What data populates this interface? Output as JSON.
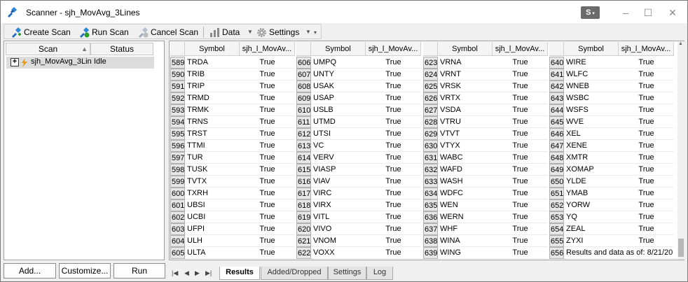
{
  "window": {
    "title": "Scanner - sjh_MovAvg_3Lines",
    "badge": "S"
  },
  "toolbar": {
    "create_scan": "Create Scan",
    "run_scan": "Run Scan",
    "cancel_scan": "Cancel Scan",
    "data": "Data",
    "settings": "Settings"
  },
  "left": {
    "col_scan": "Scan",
    "col_status": "Status",
    "scan_name": "sjh_MovAvg_3Lin",
    "scan_status": "Idle"
  },
  "buttons": {
    "add": "Add...",
    "customize": "Customize...",
    "run": "Run"
  },
  "grid": {
    "headers": [
      "Symbol",
      "sjh_l_MovAv..."
    ],
    "columns": [
      {
        "rows": [
          [
            "589",
            "TRDA",
            "True"
          ],
          [
            "590",
            "TRIB",
            "True"
          ],
          [
            "591",
            "TRIP",
            "True"
          ],
          [
            "592",
            "TRMD",
            "True"
          ],
          [
            "593",
            "TRMK",
            "True"
          ],
          [
            "594",
            "TRNS",
            "True"
          ],
          [
            "595",
            "TRST",
            "True"
          ],
          [
            "596",
            "TTMI",
            "True"
          ],
          [
            "597",
            "TUR",
            "True"
          ],
          [
            "598",
            "TUSK",
            "True"
          ],
          [
            "599",
            "TVTX",
            "True"
          ],
          [
            "600",
            "TXRH",
            "True"
          ],
          [
            "601",
            "UBSI",
            "True"
          ],
          [
            "602",
            "UCBI",
            "True"
          ],
          [
            "603",
            "UFPI",
            "True"
          ],
          [
            "604",
            "ULH",
            "True"
          ],
          [
            "605",
            "ULTA",
            "True"
          ]
        ]
      },
      {
        "rows": [
          [
            "606",
            "UMPQ",
            "True"
          ],
          [
            "607",
            "UNTY",
            "True"
          ],
          [
            "608",
            "USAK",
            "True"
          ],
          [
            "609",
            "USAP",
            "True"
          ],
          [
            "610",
            "USLB",
            "True"
          ],
          [
            "611",
            "UTMD",
            "True"
          ],
          [
            "612",
            "UTSI",
            "True"
          ],
          [
            "613",
            "VC",
            "True"
          ],
          [
            "614",
            "VERV",
            "True"
          ],
          [
            "615",
            "VIASP",
            "True"
          ],
          [
            "616",
            "VIAV",
            "True"
          ],
          [
            "617",
            "VIRC",
            "True"
          ],
          [
            "618",
            "VIRX",
            "True"
          ],
          [
            "619",
            "VITL",
            "True"
          ],
          [
            "620",
            "VIVO",
            "True"
          ],
          [
            "621",
            "VNOM",
            "True"
          ],
          [
            "622",
            "VOXX",
            "True"
          ]
        ]
      },
      {
        "rows": [
          [
            "623",
            "VRNA",
            "True"
          ],
          [
            "624",
            "VRNT",
            "True"
          ],
          [
            "625",
            "VRSK",
            "True"
          ],
          [
            "626",
            "VRTX",
            "True"
          ],
          [
            "627",
            "VSDA",
            "True"
          ],
          [
            "628",
            "VTRU",
            "True"
          ],
          [
            "629",
            "VTVT",
            "True"
          ],
          [
            "630",
            "VTYX",
            "True"
          ],
          [
            "631",
            "WABC",
            "True"
          ],
          [
            "632",
            "WAFD",
            "True"
          ],
          [
            "633",
            "WASH",
            "True"
          ],
          [
            "634",
            "WDFC",
            "True"
          ],
          [
            "635",
            "WEN",
            "True"
          ],
          [
            "636",
            "WERN",
            "True"
          ],
          [
            "637",
            "WHF",
            "True"
          ],
          [
            "638",
            "WINA",
            "True"
          ],
          [
            "639",
            "WING",
            "True"
          ]
        ]
      },
      {
        "rows": [
          [
            "640",
            "WIRE",
            "True"
          ],
          [
            "641",
            "WLFC",
            "True"
          ],
          [
            "642",
            "WNEB",
            "True"
          ],
          [
            "643",
            "WSBC",
            "True"
          ],
          [
            "644",
            "WSFS",
            "True"
          ],
          [
            "645",
            "WVE",
            "True"
          ],
          [
            "646",
            "XEL",
            "True"
          ],
          [
            "647",
            "XENE",
            "True"
          ],
          [
            "648",
            "XMTR",
            "True"
          ],
          [
            "649",
            "XOMAP",
            "True"
          ],
          [
            "650",
            "YLDE",
            "True"
          ],
          [
            "651",
            "YMAB",
            "True"
          ],
          [
            "652",
            "YORW",
            "True"
          ],
          [
            "653",
            "YQ",
            "True"
          ],
          [
            "654",
            "ZEAL",
            "True"
          ],
          [
            "655",
            "ZYXI",
            "True"
          ],
          [
            "656",
            "Results and data as of: 8/21/20",
            ""
          ]
        ]
      }
    ]
  },
  "tabs": [
    "Results",
    "Added/Dropped",
    "Settings",
    "Log"
  ]
}
